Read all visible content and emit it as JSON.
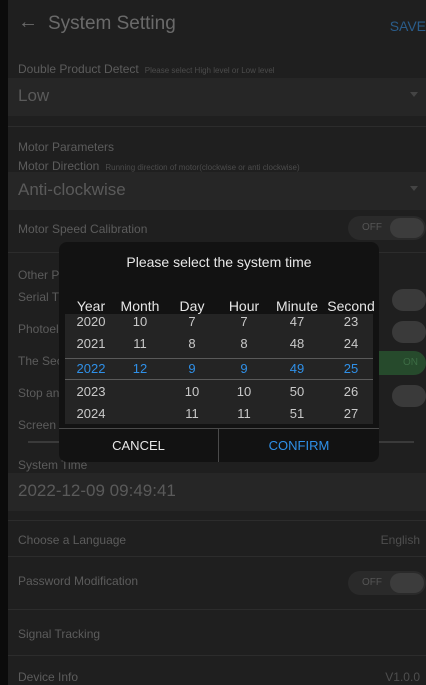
{
  "header": {
    "title": "System Setting",
    "save_label": "SAVE"
  },
  "double_product": {
    "label": "Double Product Detect",
    "hint": "Please select High level or Low level",
    "value": "Low"
  },
  "motor": {
    "section": "Motor Parameters",
    "direction_label": "Motor Direction",
    "direction_hint": "Running direction of motor(clockwise or anti clockwise)",
    "direction_value": "Anti-clockwise",
    "speed_label": "Motor Speed Calibration",
    "speed_toggle": "OFF"
  },
  "other": {
    "section": "Other P",
    "serial": "Serial Tr",
    "photo": "Photoele",
    "second": "The Sec",
    "stop": "Stop and",
    "second_toggle": "ON",
    "screen": "Screen B"
  },
  "system_time": {
    "label": "System Time",
    "value": "2022-12-09 09:49:41"
  },
  "language": {
    "label": "Choose a Language",
    "value": "English"
  },
  "password": {
    "label": "Password Modification",
    "toggle": "OFF"
  },
  "signal": {
    "label": "Signal Tracking"
  },
  "device": {
    "label": "Device Info",
    "version": "V1.0.0"
  },
  "dialog": {
    "title": "Please select the system time",
    "columns": [
      "Year",
      "Month",
      "Day",
      "Hour",
      "Minute",
      "Second"
    ],
    "year": [
      "2020",
      "2021",
      "2022",
      "2023",
      "2024"
    ],
    "month": [
      "10",
      "11",
      "12",
      "",
      ""
    ],
    "day": [
      "7",
      "8",
      "9",
      "10",
      "11"
    ],
    "hour": [
      "7",
      "8",
      "9",
      "10",
      "11"
    ],
    "minute": [
      "47",
      "48",
      "49",
      "50",
      "51"
    ],
    "second": [
      "23",
      "24",
      "25",
      "26",
      "27"
    ],
    "selected_index": 2,
    "cancel": "CANCEL",
    "confirm": "CONFIRM"
  },
  "colors": {
    "accent": "#2f90e8",
    "background": "#1f1f1f",
    "dialog": "#121212"
  }
}
